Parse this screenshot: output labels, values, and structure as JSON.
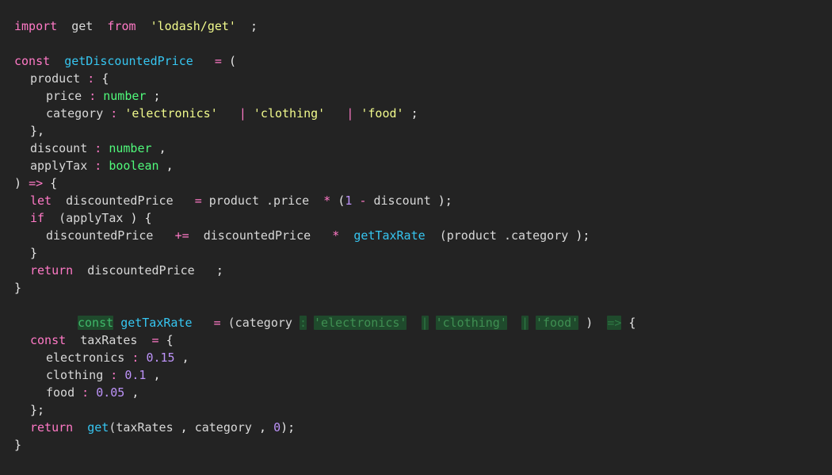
{
  "editor": {
    "background": "#232323",
    "lines": [
      {
        "indent": 0,
        "tokens": [
          {
            "t": "import",
            "c": "kw"
          },
          {
            "t": "  "
          },
          {
            "t": "get",
            "c": "id"
          },
          {
            "t": "  "
          },
          {
            "t": "from",
            "c": "kw"
          },
          {
            "t": "  "
          },
          {
            "t": "'lodash/get'",
            "c": "str"
          },
          {
            "t": "  "
          },
          {
            "t": ";",
            "c": "pn"
          }
        ]
      },
      {
        "indent": 0,
        "tokens": []
      },
      {
        "indent": 0,
        "tokens": [
          {
            "t": "const",
            "c": "kw"
          },
          {
            "t": "  "
          },
          {
            "t": "getDiscountedPrice",
            "c": "fn"
          },
          {
            "t": "   "
          },
          {
            "t": "=",
            "c": "op"
          },
          {
            "t": " "
          },
          {
            "t": "(",
            "c": "pn"
          }
        ]
      },
      {
        "indent": 1,
        "tokens": [
          {
            "t": "product",
            "c": "id"
          },
          {
            "t": " "
          },
          {
            "t": ":",
            "c": "op"
          },
          {
            "t": " "
          },
          {
            "t": "{",
            "c": "pn"
          }
        ]
      },
      {
        "indent": 2,
        "tokens": [
          {
            "t": "price",
            "c": "id"
          },
          {
            "t": " "
          },
          {
            "t": ":",
            "c": "op"
          },
          {
            "t": " "
          },
          {
            "t": "number",
            "c": "ty"
          },
          {
            "t": " "
          },
          {
            "t": ";",
            "c": "pn"
          }
        ]
      },
      {
        "indent": 2,
        "tokens": [
          {
            "t": "category",
            "c": "id"
          },
          {
            "t": " "
          },
          {
            "t": ":",
            "c": "op"
          },
          {
            "t": " "
          },
          {
            "t": "'electronics'",
            "c": "str"
          },
          {
            "t": "   "
          },
          {
            "t": "|",
            "c": "op"
          },
          {
            "t": " "
          },
          {
            "t": "'clothing'",
            "c": "str"
          },
          {
            "t": "   "
          },
          {
            "t": "|",
            "c": "op"
          },
          {
            "t": " "
          },
          {
            "t": "'food'",
            "c": "str"
          },
          {
            "t": " "
          },
          {
            "t": ";",
            "c": "pn"
          }
        ]
      },
      {
        "indent": 1,
        "tokens": [
          {
            "t": "},",
            "c": "pn"
          }
        ]
      },
      {
        "indent": 1,
        "tokens": [
          {
            "t": "discount",
            "c": "id"
          },
          {
            "t": " "
          },
          {
            "t": ":",
            "c": "op"
          },
          {
            "t": " "
          },
          {
            "t": "number",
            "c": "ty"
          },
          {
            "t": " "
          },
          {
            "t": ",",
            "c": "pn"
          }
        ]
      },
      {
        "indent": 1,
        "tokens": [
          {
            "t": "applyTax",
            "c": "id"
          },
          {
            "t": " "
          },
          {
            "t": ":",
            "c": "op"
          },
          {
            "t": " "
          },
          {
            "t": "boolean",
            "c": "ty"
          },
          {
            "t": " "
          },
          {
            "t": ",",
            "c": "pn"
          }
        ]
      },
      {
        "indent": 0,
        "tokens": [
          {
            "t": ")",
            "c": "pn"
          },
          {
            "t": " "
          },
          {
            "t": "=>",
            "c": "op"
          },
          {
            "t": " "
          },
          {
            "t": "{",
            "c": "pn"
          }
        ]
      },
      {
        "indent": 1,
        "tokens": [
          {
            "t": "let",
            "c": "kw"
          },
          {
            "t": "  "
          },
          {
            "t": "discountedPrice",
            "c": "id"
          },
          {
            "t": "   "
          },
          {
            "t": "=",
            "c": "op"
          },
          {
            "t": " "
          },
          {
            "t": "product",
            "c": "id"
          },
          {
            "t": " "
          },
          {
            "t": ".price",
            "c": "id"
          },
          {
            "t": "  "
          },
          {
            "t": "*",
            "c": "op"
          },
          {
            "t": " "
          },
          {
            "t": "(",
            "c": "pn"
          },
          {
            "t": "1",
            "c": "num"
          },
          {
            "t": " "
          },
          {
            "t": "-",
            "c": "op"
          },
          {
            "t": " "
          },
          {
            "t": "discount",
            "c": "id"
          },
          {
            "t": " "
          },
          {
            "t": ");",
            "c": "pn"
          }
        ]
      },
      {
        "indent": 1,
        "tokens": [
          {
            "t": "if",
            "c": "kw"
          },
          {
            "t": "  "
          },
          {
            "t": "(applyTax",
            "c": "id"
          },
          {
            "t": " "
          },
          {
            "t": ")",
            "c": "pn"
          },
          {
            "t": " "
          },
          {
            "t": "{",
            "c": "pn"
          }
        ]
      },
      {
        "indent": 2,
        "tokens": [
          {
            "t": "discountedPrice",
            "c": "id"
          },
          {
            "t": "   "
          },
          {
            "t": "+=",
            "c": "op"
          },
          {
            "t": "  "
          },
          {
            "t": "discountedPrice",
            "c": "id"
          },
          {
            "t": "   "
          },
          {
            "t": "*",
            "c": "op"
          },
          {
            "t": "  "
          },
          {
            "t": "getTaxRate",
            "c": "fn"
          },
          {
            "t": "  "
          },
          {
            "t": "(product",
            "c": "id"
          },
          {
            "t": " "
          },
          {
            "t": ".category",
            "c": "id"
          },
          {
            "t": " "
          },
          {
            "t": ");",
            "c": "pn"
          }
        ]
      },
      {
        "indent": 1,
        "tokens": [
          {
            "t": "}",
            "c": "pn"
          }
        ]
      },
      {
        "indent": 1,
        "tokens": [
          {
            "t": "return",
            "c": "kw"
          },
          {
            "t": "  "
          },
          {
            "t": "discountedPrice",
            "c": "id"
          },
          {
            "t": "   "
          },
          {
            "t": ";",
            "c": "pn"
          }
        ]
      },
      {
        "indent": 0,
        "tokens": [
          {
            "t": "}",
            "c": "pn"
          }
        ]
      },
      {
        "indent": 0,
        "tokens": []
      },
      {
        "indent": 4,
        "tokens": [
          {
            "t": "const",
            "c": "kw",
            "h": true
          },
          {
            "t": " "
          },
          {
            "t": "getTaxRate",
            "c": "fn"
          },
          {
            "t": "   "
          },
          {
            "t": "=",
            "c": "op"
          },
          {
            "t": " "
          },
          {
            "t": "(category",
            "c": "id"
          },
          {
            "t": " "
          },
          {
            "t": ":",
            "c": "op",
            "h": true
          },
          {
            "t": " "
          },
          {
            "t": "'electronics'",
            "c": "str",
            "h": true
          },
          {
            "t": "  "
          },
          {
            "t": "|",
            "c": "op",
            "h": true
          },
          {
            "t": " "
          },
          {
            "t": "'clothing'",
            "c": "str",
            "h": true
          },
          {
            "t": "  "
          },
          {
            "t": "|",
            "c": "op",
            "h": true
          },
          {
            "t": " "
          },
          {
            "t": "'food'",
            "c": "str",
            "h": true
          },
          {
            "t": " "
          },
          {
            "t": ")",
            "c": "pn"
          },
          {
            "t": "  "
          },
          {
            "t": "=>",
            "c": "op",
            "h": true
          },
          {
            "t": " "
          },
          {
            "t": "{",
            "c": "pn"
          }
        ]
      },
      {
        "indent": 1,
        "tokens": [
          {
            "t": "const",
            "c": "kw"
          },
          {
            "t": "  "
          },
          {
            "t": "taxRates",
            "c": "id"
          },
          {
            "t": "  "
          },
          {
            "t": "=",
            "c": "op"
          },
          {
            "t": " "
          },
          {
            "t": "{",
            "c": "pn"
          }
        ]
      },
      {
        "indent": 2,
        "tokens": [
          {
            "t": "electronics",
            "c": "id"
          },
          {
            "t": " "
          },
          {
            "t": ":",
            "c": "op"
          },
          {
            "t": " "
          },
          {
            "t": "0.15",
            "c": "num"
          },
          {
            "t": " "
          },
          {
            "t": ",",
            "c": "pn"
          }
        ]
      },
      {
        "indent": 2,
        "tokens": [
          {
            "t": "clothing",
            "c": "id"
          },
          {
            "t": " "
          },
          {
            "t": ":",
            "c": "op"
          },
          {
            "t": " "
          },
          {
            "t": "0.1",
            "c": "num"
          },
          {
            "t": " "
          },
          {
            "t": ",",
            "c": "pn"
          }
        ]
      },
      {
        "indent": 2,
        "tokens": [
          {
            "t": "food",
            "c": "id"
          },
          {
            "t": " "
          },
          {
            "t": ":",
            "c": "op"
          },
          {
            "t": " "
          },
          {
            "t": "0.05",
            "c": "num"
          },
          {
            "t": " "
          },
          {
            "t": ",",
            "c": "pn"
          }
        ]
      },
      {
        "indent": 1,
        "tokens": [
          {
            "t": "};",
            "c": "pn"
          }
        ]
      },
      {
        "indent": 1,
        "tokens": [
          {
            "t": "return",
            "c": "kw"
          },
          {
            "t": "  "
          },
          {
            "t": "get",
            "c": "fn"
          },
          {
            "t": "(taxRates",
            "c": "id"
          },
          {
            "t": " "
          },
          {
            "t": ",",
            "c": "pn"
          },
          {
            "t": " "
          },
          {
            "t": "category",
            "c": "id"
          },
          {
            "t": " "
          },
          {
            "t": ",",
            "c": "pn"
          },
          {
            "t": " "
          },
          {
            "t": "0",
            "c": "num"
          },
          {
            "t": ");",
            "c": "pn"
          }
        ]
      },
      {
        "indent": 0,
        "tokens": [
          {
            "t": "}",
            "c": "pn"
          }
        ]
      }
    ]
  }
}
